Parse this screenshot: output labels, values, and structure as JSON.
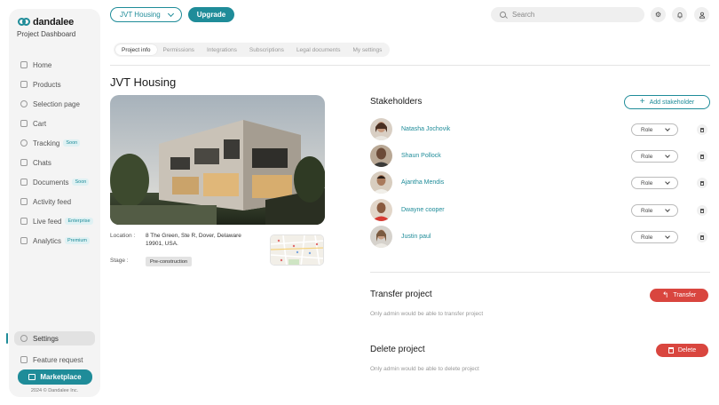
{
  "brand": {
    "name": "dandalee",
    "subtitle": "Project Dashboard",
    "copyright": "2024 © Dandalee Inc."
  },
  "nav": [
    {
      "label": "Home",
      "icon": "home-icon",
      "badge": ""
    },
    {
      "label": "Products",
      "icon": "box-icon",
      "badge": ""
    },
    {
      "label": "Selection page",
      "icon": "check-circle-icon",
      "badge": ""
    },
    {
      "label": "Cart",
      "icon": "cart-icon",
      "badge": ""
    },
    {
      "label": "Tracking",
      "icon": "tracking-icon",
      "badge": "Soon"
    },
    {
      "label": "Chats",
      "icon": "chat-icon",
      "badge": ""
    },
    {
      "label": "Documents",
      "icon": "document-icon",
      "badge": "Soon"
    },
    {
      "label": "Activity feed",
      "icon": "activity-icon",
      "badge": ""
    },
    {
      "label": "Live feed",
      "icon": "video-icon",
      "badge": "Enterprise"
    },
    {
      "label": "Analytics",
      "icon": "chart-icon",
      "badge": "Premium"
    }
  ],
  "nav_bottom": {
    "settings": "Settings",
    "feature_request": "Feature request",
    "marketplace": "Marketplace"
  },
  "topbar": {
    "project": "JVT Housing",
    "upgrade": "Upgrade",
    "search_placeholder": "Search"
  },
  "tabs": [
    "Project info",
    "Permissions",
    "Integrations",
    "Subscriptions",
    "Legal documents",
    "My settings"
  ],
  "project": {
    "title": "JVT Housing",
    "location_label": "Location :",
    "location": "8 The Green, Ste R, Dover, Delaware 19901, USA.",
    "stage_label": "Stage :",
    "stage": "Pre-construction"
  },
  "stakeholders": {
    "title": "Stakeholders",
    "add_label": "Add stakeholder",
    "role_label": "Role",
    "people": [
      {
        "name": "Natasha Jochovik"
      },
      {
        "name": "Shaun Pollock"
      },
      {
        "name": "Ajantha Mendis"
      },
      {
        "name": "Dwayne cooper"
      },
      {
        "name": "Justin paul"
      }
    ]
  },
  "transfer": {
    "title": "Transfer project",
    "note": "Only admin would be able to transfer project",
    "button": "Transfer"
  },
  "delete": {
    "title": "Delete project",
    "note": "Only admin would be able to delete project",
    "button": "Delete"
  },
  "colors": {
    "accent": "#1f8c99",
    "danger": "#d9463f"
  }
}
